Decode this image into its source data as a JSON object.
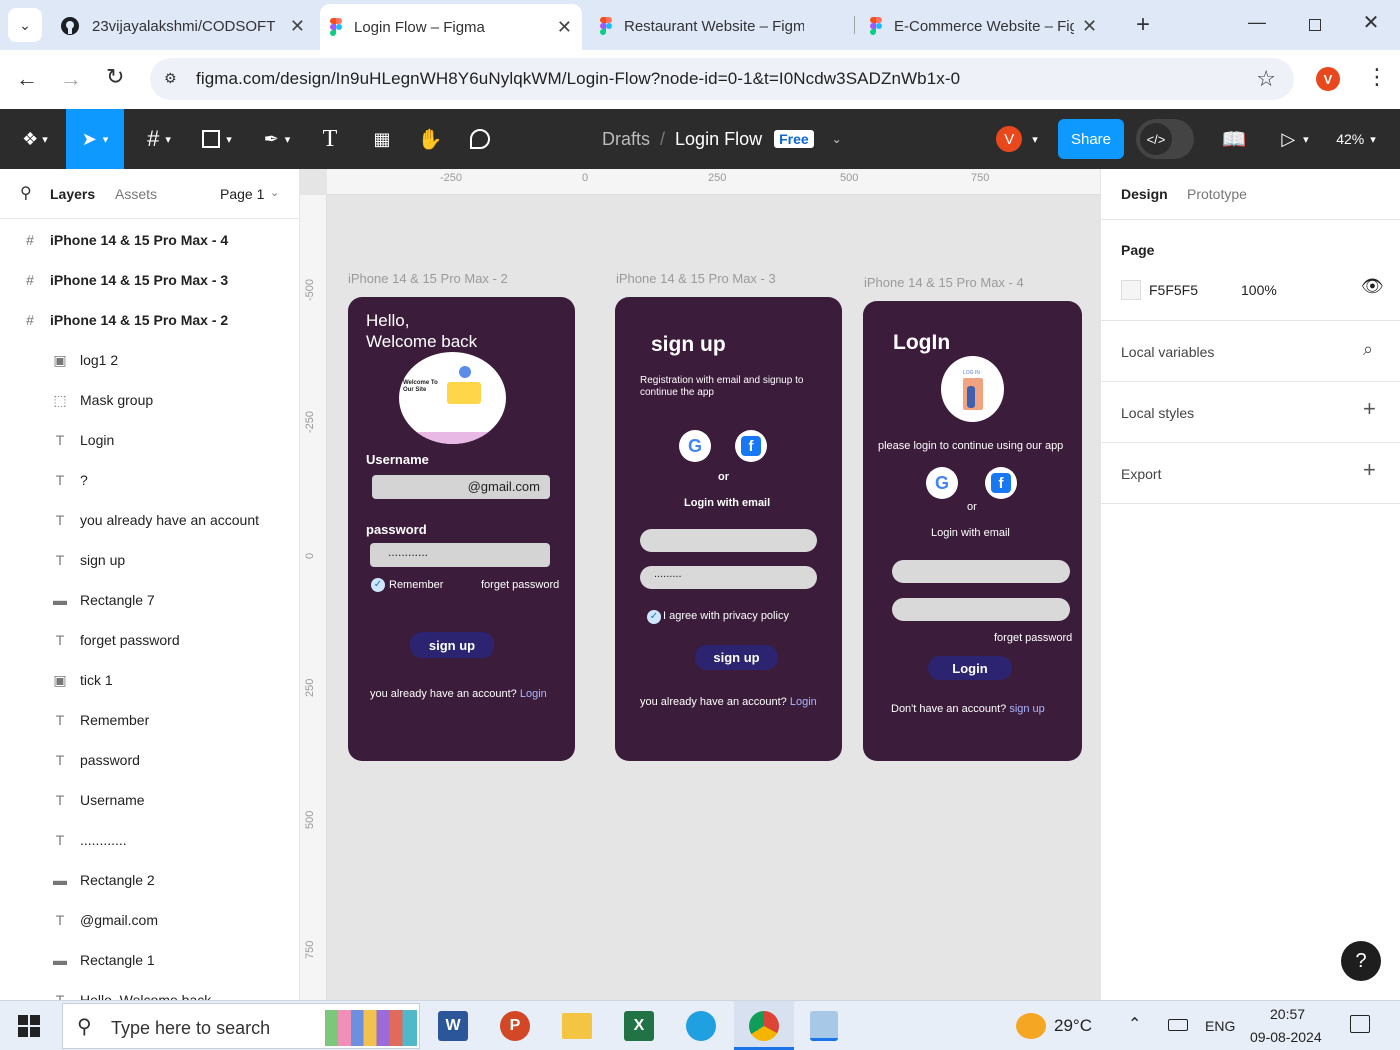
{
  "browser": {
    "tabs": [
      {
        "title": "23vijayalakshmi/CODSOFT",
        "icon": "github-icon"
      },
      {
        "title": "Login Flow – Figma",
        "icon": "figma-icon"
      },
      {
        "title": "Restaurant Website – Figma",
        "icon": "figma-icon"
      },
      {
        "title": "E-Commerce Website – Figma",
        "icon": "figma-icon"
      }
    ],
    "url": "figma.com/design/In9uHLegnWH8Y6uNylqkWM/Login-Flow?node-id=0-1&t=I0Ncdw3SADZnWb1x-0",
    "profile_initial": "V"
  },
  "toolbar": {
    "breadcrumb_root": "Drafts",
    "file_name": "Login Flow",
    "plan_badge": "Free",
    "user_initial": "V",
    "share_label": "Share",
    "zoom": "42%"
  },
  "left_panel": {
    "tab_layers": "Layers",
    "tab_assets": "Assets",
    "page_selector": "Page 1",
    "layers": [
      {
        "name": "iPhone 14 & 15 Pro Max - 4",
        "type": "frame",
        "bold": true
      },
      {
        "name": "iPhone 14 & 15 Pro Max - 3",
        "type": "frame",
        "bold": true
      },
      {
        "name": "iPhone 14 & 15 Pro Max - 2",
        "type": "frame",
        "bold": true
      },
      {
        "name": "log1 2",
        "type": "image"
      },
      {
        "name": "Mask group",
        "type": "mask"
      },
      {
        "name": "Login",
        "type": "text"
      },
      {
        "name": "?",
        "type": "text"
      },
      {
        "name": "you already have an account",
        "type": "text"
      },
      {
        "name": "sign up",
        "type": "text"
      },
      {
        "name": "Rectangle 7",
        "type": "rect"
      },
      {
        "name": "forget password",
        "type": "text"
      },
      {
        "name": "tick 1",
        "type": "image"
      },
      {
        "name": "Remember",
        "type": "text"
      },
      {
        "name": "password",
        "type": "text"
      },
      {
        "name": "Username",
        "type": "text"
      },
      {
        "name": "............",
        "type": "text"
      },
      {
        "name": "Rectangle 2",
        "type": "rect"
      },
      {
        "name": "@gmail.com",
        "type": "text"
      },
      {
        "name": "Rectangle 1",
        "type": "rect"
      },
      {
        "name": "Hello, Welcome back",
        "type": "text"
      }
    ]
  },
  "rulers": {
    "h": [
      "-250",
      "0",
      "250",
      "500",
      "750"
    ],
    "v": [
      "-500",
      "-250",
      "0",
      "250",
      "500",
      "750"
    ]
  },
  "frames": {
    "f2": {
      "label": "iPhone 14 & 15 Pro Max - 2",
      "greeting": "Hello,",
      "greeting2": "Welcome back",
      "illustration_title": "Welcome To Our Site",
      "username_label": "Username",
      "email_value": "@gmail.com",
      "password_label": "password",
      "password_value": "............",
      "remember": "Remember",
      "forget": "forget password",
      "button": "sign up",
      "footer": "you already have an account?",
      "footer_link": "Login"
    },
    "f3": {
      "label": "iPhone 14 & 15 Pro Max - 3",
      "title": "sign up",
      "subtitle": "Registration with email  and signup to continue the app",
      "or": "or",
      "login_email": "Login with email",
      "password_value": ".........",
      "agree": "I agree with privacy policy",
      "button": "sign up",
      "footer": "you already have an account?",
      "footer_link": "Login"
    },
    "f4": {
      "label": "iPhone 14 & 15 Pro Max - 4",
      "title": "LogIn",
      "illustration_text": "LOG IN",
      "subtitle": "please login to continue using our app",
      "or": "or",
      "login_email": "Login with email",
      "forget": "forget password",
      "button": "Login",
      "footer": "Don't have an account?",
      "footer_link": "sign up"
    }
  },
  "right_panel": {
    "tab_design": "Design",
    "tab_prototype": "Prototype",
    "page_heading": "Page",
    "page_color": "F5F5F5",
    "page_opacity": "100%",
    "local_variables": "Local variables",
    "local_styles": "Local styles",
    "export": "Export"
  },
  "taskbar": {
    "search_placeholder": "Type here to search",
    "weather": "29°C",
    "language": "ENG",
    "time": "20:57",
    "date": "09-08-2024"
  },
  "help_label": "?",
  "colors": {
    "frame_bg": "#3b1c3a",
    "button": "#2c2470",
    "share": "#0d99ff",
    "active_tool": "#0d99ff",
    "avatar": "#e8481c"
  }
}
